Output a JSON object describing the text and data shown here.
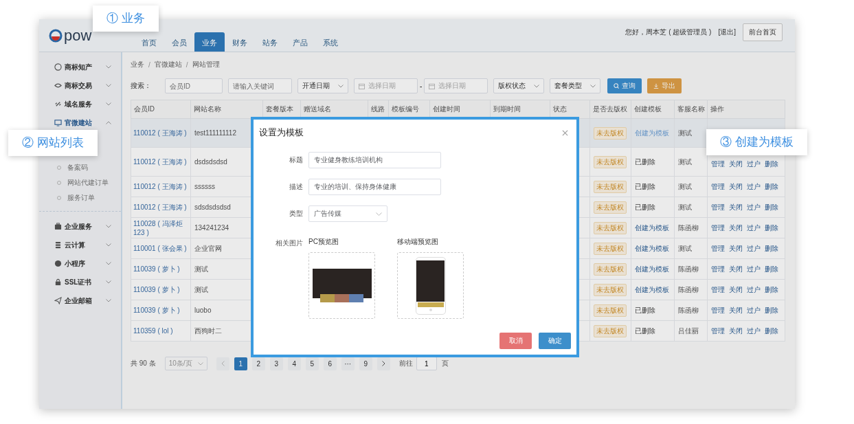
{
  "header": {
    "logo_text": "pow",
    "nav": [
      {
        "label": "首页",
        "selected": false
      },
      {
        "label": "会员",
        "selected": false
      },
      {
        "label": "业务",
        "selected": true
      },
      {
        "label": "财务",
        "selected": false
      },
      {
        "label": "站务",
        "selected": false
      },
      {
        "label": "产品",
        "selected": false
      },
      {
        "label": "系统",
        "selected": false
      }
    ],
    "greeting": "您好，周本芝 ( 超级管理员 )",
    "logout": "[退出]",
    "home_button": "前台首页"
  },
  "sidebar": {
    "items": [
      {
        "label": "商标知产",
        "expanded": false,
        "selected": false
      },
      {
        "label": "商标交易",
        "expanded": false,
        "selected": false
      },
      {
        "label": "域名服务",
        "expanded": false,
        "selected": false
      },
      {
        "label": "官微建站",
        "expanded": true,
        "selected": true,
        "children": [
          {
            "label": "备案码",
            "selected": false
          },
          {
            "label": "网站代建订单",
            "selected": false
          },
          {
            "label": "服务订单",
            "selected": false
          }
        ]
      },
      {
        "label": "企业服务",
        "expanded": false,
        "selected": false
      },
      {
        "label": "云计算",
        "expanded": false,
        "selected": false
      },
      {
        "label": "小程序",
        "expanded": false,
        "selected": false
      },
      {
        "label": "SSL证书",
        "expanded": false,
        "selected": false
      },
      {
        "label": "企业邮箱",
        "expanded": false,
        "selected": false
      }
    ]
  },
  "breadcrumb": [
    "业务",
    "官微建站",
    "网站管理"
  ],
  "breadcrumb_separator": "/",
  "search": {
    "label": "搜索：",
    "filters": [
      {
        "kind": "input",
        "placeholder": "会员ID"
      },
      {
        "kind": "input",
        "placeholder": "请输入关键词"
      },
      {
        "kind": "select",
        "value": "开通日期"
      },
      {
        "kind": "date",
        "placeholder": "选择日期"
      },
      {
        "kind": "separator",
        "text": "-"
      },
      {
        "kind": "date",
        "placeholder": "选择日期"
      },
      {
        "kind": "select",
        "value": "版权状态"
      },
      {
        "kind": "select",
        "value": "套餐类型"
      }
    ],
    "query_button": "查询",
    "export_button": "导出"
  },
  "table": {
    "columns": [
      "会员ID",
      "网站名称",
      "套餐版本",
      "赠送域名",
      "线路",
      "模板编号",
      "创建时间",
      "到期时间",
      "状态",
      "是否去版权",
      "创建模板",
      "客服名称",
      "操作"
    ],
    "rows": [
      {
        "member_id": "110012 ( 王海涛 )",
        "site_name": "test111111112",
        "copyright": "未去版权",
        "template": "创建为模板",
        "template_is_link": true,
        "service": "测试",
        "selected": true
      },
      {
        "member_id": "110012 ( 王海涛 )",
        "site_name": "dsdsdsdsd",
        "copyright": "未去版权",
        "template": "已删除",
        "template_is_link": false,
        "service": "测试",
        "actions": [
          "管理",
          "关闭",
          "过户",
          "删除"
        ],
        "selected": false
      },
      {
        "member_id": "110012 ( 王海涛 )",
        "site_name": "ssssss",
        "copyright": "未去版权",
        "template": "已删除",
        "template_is_link": false,
        "service": "测试",
        "actions": [
          "管理",
          "关闭",
          "过户",
          "删除"
        ],
        "selected": false
      },
      {
        "member_id": "110012 ( 王海涛 )",
        "site_name": "sdsdsdsdsd",
        "copyright": "未去版权",
        "template": "已删除",
        "template_is_link": false,
        "service": "测试",
        "actions": [
          "管理",
          "关闭",
          "过户",
          "删除"
        ],
        "selected": false
      },
      {
        "member_id": "110028 ( 冯泽炬123 )",
        "site_name": "134241234",
        "copyright": "未去版权",
        "template": "创建为模板",
        "template_is_link": true,
        "service": "陈函柳",
        "actions": [
          "管理",
          "关闭",
          "过户",
          "删除"
        ],
        "selected": false
      },
      {
        "member_id": "110001 ( 张会果 )",
        "site_name": "企业官网",
        "copyright": "未去版权",
        "template": "创建为模板",
        "template_is_link": true,
        "service": "测试",
        "actions": [
          "管理",
          "关闭",
          "过户",
          "删除"
        ],
        "selected": false
      },
      {
        "member_id": "110039 ( 萝卜 )",
        "site_name": "测试",
        "copyright": "未去版权",
        "template": "创建为模板",
        "template_is_link": true,
        "service": "陈函柳",
        "actions": [
          "管理",
          "关闭",
          "过户",
          "删除"
        ],
        "selected": false
      },
      {
        "member_id": "110039 ( 萝卜 )",
        "site_name": "测试",
        "copyright": "未去版权",
        "template": "创建为模板",
        "template_is_link": true,
        "service": "陈函柳",
        "actions": [
          "管理",
          "关闭",
          "过户",
          "删除"
        ],
        "selected": false
      },
      {
        "member_id": "110039 ( 萝卜 )",
        "site_name": "luobo",
        "copyright": "未去版权",
        "template": "已删除",
        "template_is_link": false,
        "service": "陈函柳",
        "actions": [
          "管理",
          "关闭",
          "过户",
          "删除"
        ],
        "selected": false
      },
      {
        "member_id": "110359 ( lol )",
        "site_name": "西狗时二",
        "copyright": "未去版权",
        "template": "已删除",
        "template_is_link": false,
        "service": "吕佳丽",
        "actions": [
          "管理",
          "关闭",
          "过户",
          "删除"
        ],
        "selected": false
      }
    ]
  },
  "pagination": {
    "total": "共 90 条",
    "page_size": "10条/页",
    "pages": [
      {
        "label": "1",
        "selected": true
      },
      {
        "label": "2",
        "selected": false
      },
      {
        "label": "3",
        "selected": false
      },
      {
        "label": "4",
        "selected": false
      },
      {
        "label": "5",
        "selected": false
      },
      {
        "label": "6",
        "selected": false
      },
      {
        "label": "···",
        "selected": false
      },
      {
        "label": "9",
        "selected": false
      }
    ],
    "goto_label": "前往",
    "goto_value": "1",
    "goto_unit": "页"
  },
  "dialog": {
    "title": "设置为模板",
    "fields": [
      {
        "label": "标题",
        "kind": "input",
        "value": "专业健身教练培训机构"
      },
      {
        "label": "描述",
        "kind": "input",
        "value": "专业的培训、保持身体健康"
      },
      {
        "label": "类型",
        "kind": "select",
        "value": "广告传媒"
      }
    ],
    "images_label": "相关图片",
    "previews": [
      {
        "kind": "pc",
        "caption": "PC预览图"
      },
      {
        "kind": "mobile",
        "caption": "移动端预览图"
      }
    ],
    "cancel_button": "取消",
    "confirm_button": "确定"
  },
  "callouts": [
    "① 业务",
    "② 网站列表",
    "③ 创建为模板"
  ]
}
